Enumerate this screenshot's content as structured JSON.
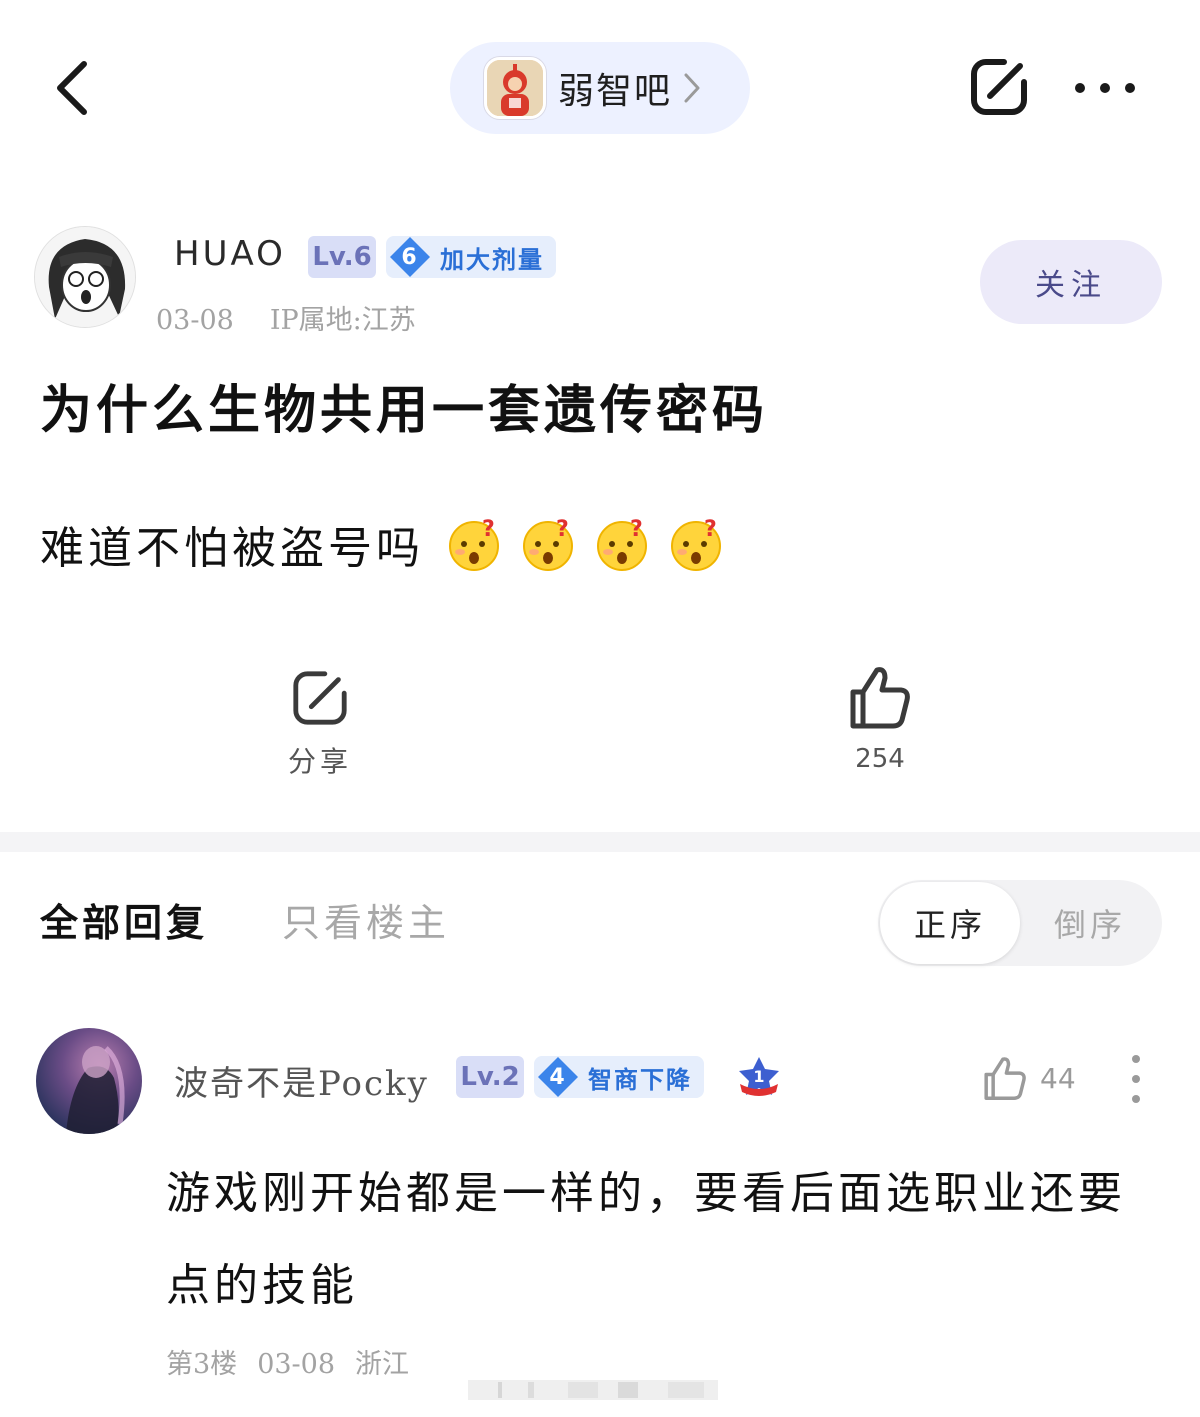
{
  "header": {
    "back_icon": "chevron-left-icon",
    "forum_name": "弱智吧",
    "share_icon": "share-icon",
    "more_icon": "more-dots-icon"
  },
  "post": {
    "author": {
      "name": "HUAO",
      "level": "Lv.6",
      "title_level": "6",
      "title": "加大剂量",
      "date": "03-08",
      "ip": "IP属地:江苏"
    },
    "follow_label": "关注",
    "title": "为什么生物共用一套遗传密码",
    "body": "难道不怕被盗号吗",
    "emoji_icon": "confused-face-icon",
    "emoji_count": 4,
    "share_label": "分享",
    "like_count": "254"
  },
  "replies_header": {
    "tab_all": "全部回复",
    "tab_op": "只看楼主",
    "sort_asc": "正序",
    "sort_desc": "倒序"
  },
  "reply": {
    "name": "波奇不是Pocky",
    "level": "Lv.2",
    "title_level": "4",
    "title": "智商下降",
    "medal": "1",
    "like_count": "44",
    "text": "游戏刚开始都是一样的，要看后面选职业还要点的技能",
    "floor": "第3楼",
    "date": "03-08",
    "location": "浙江"
  },
  "colors": {
    "accent_blue": "#2a6fd6",
    "level_badge_bg": "#d9def7",
    "level_badge_text": "#6b72b8",
    "follow_bg": "#eceaf9",
    "muted_text": "#a3a3a3"
  }
}
